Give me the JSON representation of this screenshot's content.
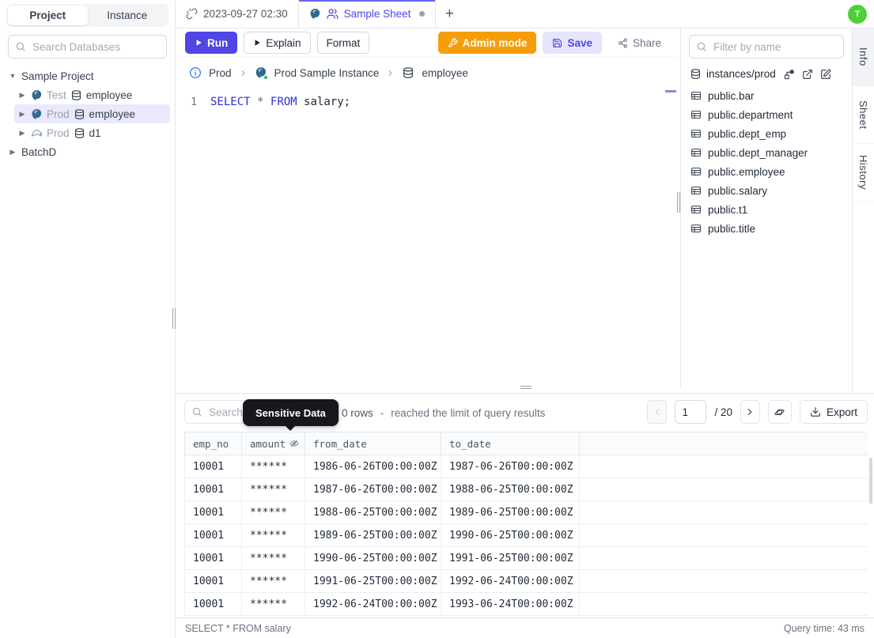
{
  "colors": {
    "accent": "#4f46e5",
    "tab_active_border": "#6366f1",
    "admin_orange": "#f59e0b",
    "avatar_green": "#4cd137",
    "selected_tree_bg": "#e9e8fc",
    "status_green": "#22c55e"
  },
  "sidebar": {
    "tabs": {
      "project": "Project",
      "instance": "Instance"
    },
    "search_placeholder": "Search Databases",
    "tree": {
      "root_expanded": "Sample Project",
      "databases": [
        {
          "env": "Test",
          "name": "employee",
          "engine": "postgres"
        },
        {
          "env": "Prod",
          "name": "employee",
          "engine": "postgres"
        },
        {
          "env": "Prod",
          "name": "d1",
          "engine": "mysql"
        }
      ],
      "root_collapsed": "BatchD"
    }
  },
  "sheet_tabbar": {
    "history_tab": "2023-09-27 02:30",
    "active_tab": "Sample Sheet",
    "new_tab_label": "+",
    "avatar_initial": "T"
  },
  "toolbar": {
    "run": "Run",
    "explain": "Explain",
    "format": "Format",
    "admin_mode": "Admin mode",
    "save": "Save",
    "share": "Share"
  },
  "breadcrumb": {
    "environment": "Prod",
    "instance": "Prod Sample Instance",
    "database": "employee"
  },
  "editor": {
    "line_number": "1",
    "keyword_select": "SELECT",
    "operator_star": "*",
    "keyword_from": "FROM",
    "identifier": "salary;"
  },
  "right_panel": {
    "filter_placeholder": "Filter by name",
    "connection": "instances/prod",
    "tables": [
      "public.bar",
      "public.department",
      "public.dept_emp",
      "public.dept_manager",
      "public.employee",
      "public.salary",
      "public.t1",
      "public.title"
    ]
  },
  "side_tabs": {
    "info": "Info",
    "sheet": "Sheet",
    "history": "History"
  },
  "results": {
    "search_placeholder": "Search",
    "tooltip": "Sensitive Data",
    "row_count": "0 rows",
    "separator": "-",
    "limit_note": "reached the limit of query results",
    "page_value": "1",
    "page_total": "/ 20",
    "export_label": "Export",
    "columns": [
      "emp_no",
      "amount",
      "from_date",
      "to_date"
    ],
    "rows": [
      [
        "10001",
        "******",
        "1986-06-26T00:00:00Z",
        "1987-06-26T00:00:00Z"
      ],
      [
        "10001",
        "******",
        "1987-06-26T00:00:00Z",
        "1988-06-25T00:00:00Z"
      ],
      [
        "10001",
        "******",
        "1988-06-25T00:00:00Z",
        "1989-06-25T00:00:00Z"
      ],
      [
        "10001",
        "******",
        "1989-06-25T00:00:00Z",
        "1990-06-25T00:00:00Z"
      ],
      [
        "10001",
        "******",
        "1990-06-25T00:00:00Z",
        "1991-06-25T00:00:00Z"
      ],
      [
        "10001",
        "******",
        "1991-06-25T00:00:00Z",
        "1992-06-24T00:00:00Z"
      ],
      [
        "10001",
        "******",
        "1992-06-24T00:00:00Z",
        "1993-06-24T00:00:00Z"
      ]
    ]
  },
  "status_bar": {
    "statement": "SELECT * FROM salary",
    "query_time": "Query time: 43 ms"
  }
}
